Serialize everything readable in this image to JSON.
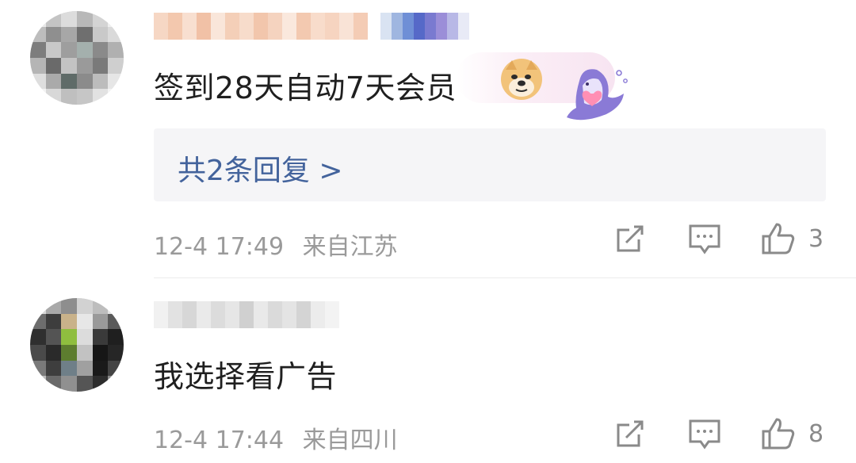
{
  "comments": [
    {
      "text": "签到28天自动7天会员",
      "replies_link": "共2条回复 >",
      "date": "12-4 17:49",
      "location": "来自江苏",
      "likes": "3"
    },
    {
      "text": "我选择看广告",
      "date": "12-4 17:44",
      "location": "来自四川",
      "likes": "8"
    }
  ],
  "icons": {
    "share": "share-icon",
    "comment": "comment-icon",
    "like": "thumbs-up-icon",
    "doge": "doge-emoji-icon",
    "sticker": "shark-heart-sticker-icon"
  },
  "colors": {
    "reply_link": "#43639c",
    "meta_text": "#9a9a9a",
    "body_text": "#1f1f1f",
    "reply_bg": "#f5f5f7"
  }
}
